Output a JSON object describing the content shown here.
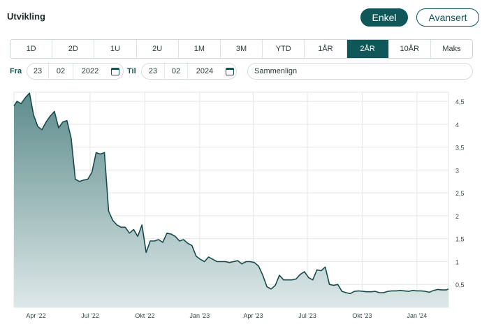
{
  "header": {
    "title": "Utvikling",
    "mode_simple": "Enkel",
    "mode_advanced": "Avansert"
  },
  "periods": [
    "1D",
    "2D",
    "1U",
    "2U",
    "1M",
    "3M",
    "YTD",
    "1ÅR",
    "2ÅR",
    "10ÅR",
    "Maks"
  ],
  "active_period": "2ÅR",
  "date_range": {
    "from_label": "Fra",
    "from": {
      "day": "23",
      "month": "02",
      "year": "2022"
    },
    "to_label": "Til",
    "to": {
      "day": "23",
      "month": "02",
      "year": "2024"
    },
    "compare_placeholder": "Sammenlign"
  },
  "colors": {
    "accent": "#0f5758",
    "line": "#184a4b",
    "fill_top": "#5e8c8c",
    "fill_bottom": "#dde8e8",
    "grid": "#e3e7e7"
  },
  "chart_data": {
    "type": "area",
    "x_ticks": [
      "Apr '22",
      "Jul '22",
      "Okt '22",
      "Jan '23",
      "Apr '23",
      "Jul '23",
      "Okt '23",
      "Jan '24"
    ],
    "y_ticks": [
      "0,5",
      "1",
      "1,5",
      "2",
      "2,5",
      "3",
      "3,5",
      "4",
      "4,5"
    ],
    "ylim": [
      0,
      4.7
    ],
    "x": [
      "2022-02-23",
      "2022-02-28",
      "2022-03-07",
      "2022-03-14",
      "2022-03-21",
      "2022-03-28",
      "2022-04-04",
      "2022-04-11",
      "2022-04-18",
      "2022-04-25",
      "2022-05-02",
      "2022-05-09",
      "2022-05-16",
      "2022-05-23",
      "2022-05-30",
      "2022-06-06",
      "2022-06-13",
      "2022-06-20",
      "2022-06-27",
      "2022-07-04",
      "2022-07-11",
      "2022-07-18",
      "2022-07-25",
      "2022-08-01",
      "2022-08-08",
      "2022-08-15",
      "2022-08-22",
      "2022-08-29",
      "2022-09-05",
      "2022-09-12",
      "2022-09-19",
      "2022-09-26",
      "2022-10-03",
      "2022-10-10",
      "2022-10-17",
      "2022-10-24",
      "2022-10-31",
      "2022-11-07",
      "2022-11-14",
      "2022-11-21",
      "2022-11-28",
      "2022-12-05",
      "2022-12-12",
      "2022-12-19",
      "2022-12-26",
      "2023-01-02",
      "2023-01-09",
      "2023-01-16",
      "2023-01-23",
      "2023-01-30",
      "2023-02-06",
      "2023-02-13",
      "2023-02-20",
      "2023-02-27",
      "2023-03-06",
      "2023-03-13",
      "2023-03-20",
      "2023-03-27",
      "2023-04-03",
      "2023-04-10",
      "2023-04-17",
      "2023-04-24",
      "2023-05-01",
      "2023-05-08",
      "2023-05-15",
      "2023-05-22",
      "2023-05-29",
      "2023-06-05",
      "2023-06-12",
      "2023-06-19",
      "2023-06-26",
      "2023-07-03",
      "2023-07-10",
      "2023-07-17",
      "2023-07-24",
      "2023-07-31",
      "2023-08-07",
      "2023-08-14",
      "2023-08-21",
      "2023-08-28",
      "2023-09-04",
      "2023-09-11",
      "2023-09-18",
      "2023-09-25",
      "2023-10-02",
      "2023-10-09",
      "2023-10-16",
      "2023-10-23",
      "2023-10-30",
      "2023-11-06",
      "2023-11-13",
      "2023-11-20",
      "2023-11-27",
      "2023-12-04",
      "2023-12-11",
      "2023-12-18",
      "2023-12-25",
      "2024-01-01",
      "2024-01-08",
      "2024-01-15",
      "2024-01-22",
      "2024-01-29",
      "2024-02-05",
      "2024-02-12",
      "2024-02-19",
      "2024-02-23"
    ],
    "values": [
      4.4,
      4.5,
      4.45,
      4.58,
      4.68,
      4.2,
      3.95,
      3.88,
      4.05,
      4.18,
      4.28,
      3.92,
      4.05,
      4.08,
      3.7,
      2.8,
      2.75,
      2.78,
      2.8,
      2.95,
      3.38,
      3.35,
      3.38,
      2.1,
      1.9,
      1.8,
      1.75,
      1.75,
      1.62,
      1.7,
      1.55,
      1.8,
      1.2,
      1.45,
      1.45,
      1.48,
      1.42,
      1.62,
      1.6,
      1.55,
      1.45,
      1.48,
      1.4,
      1.35,
      1.12,
      1.05,
      1.0,
      1.1,
      1.05,
      1.0,
      1.0,
      1.0,
      0.98,
      1.0,
      1.02,
      0.95,
      1.0,
      1.0,
      0.98,
      0.9,
      0.7,
      0.45,
      0.4,
      0.48,
      0.7,
      0.6,
      0.6,
      0.6,
      0.62,
      0.72,
      0.78,
      0.65,
      0.6,
      0.82,
      0.8,
      0.88,
      0.5,
      0.48,
      0.5,
      0.35,
      0.32,
      0.3,
      0.35,
      0.36,
      0.35,
      0.34,
      0.34,
      0.35,
      0.32,
      0.32,
      0.35,
      0.36,
      0.36,
      0.37,
      0.36,
      0.35,
      0.37,
      0.36,
      0.36,
      0.35,
      0.33,
      0.37,
      0.39,
      0.38,
      0.38,
      0.4
    ]
  }
}
